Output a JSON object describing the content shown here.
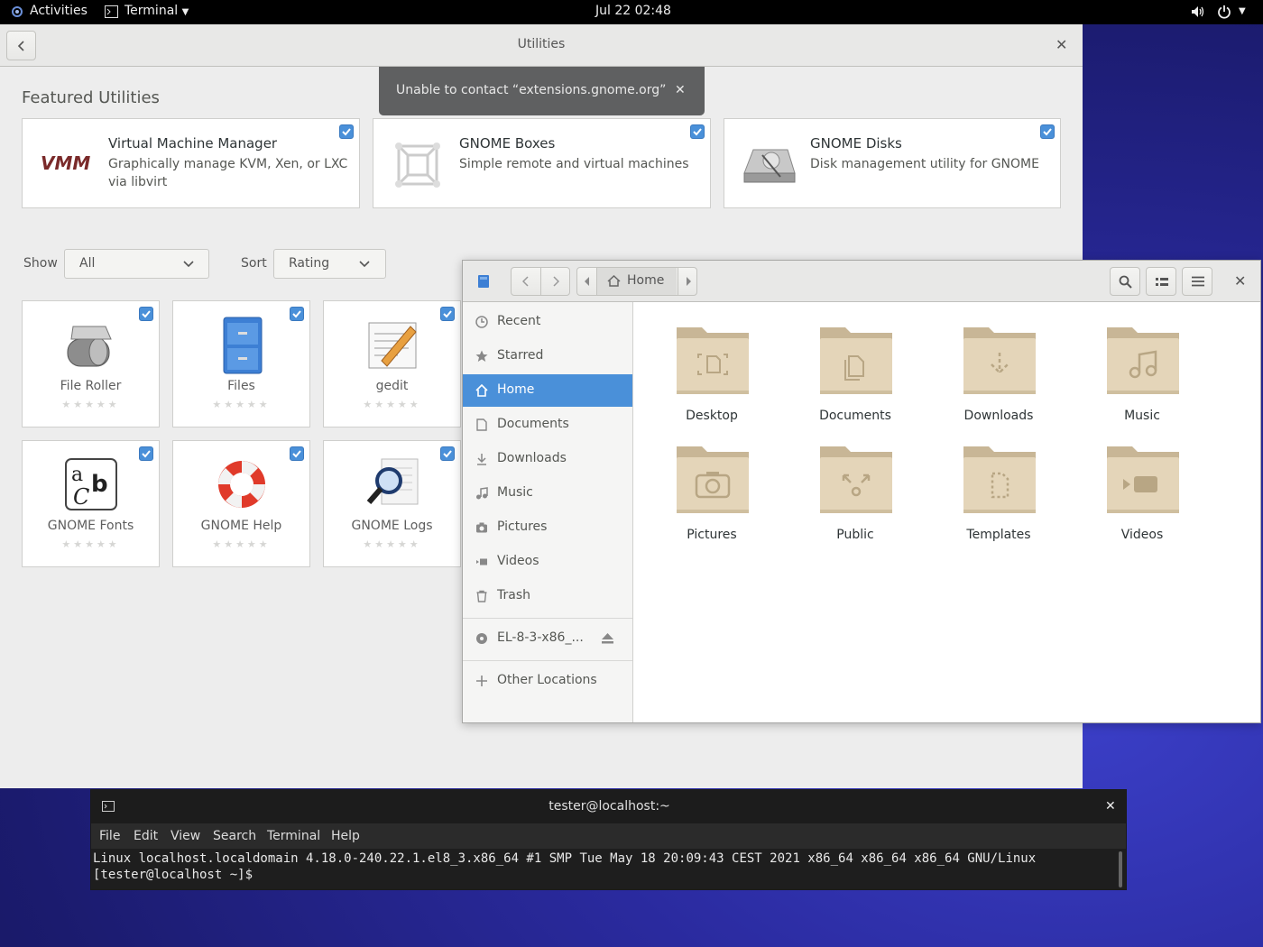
{
  "topbar": {
    "activities": "Activities",
    "app_menu": "Terminal",
    "clock": "Jul 22  02:48"
  },
  "software": {
    "title": "Utilities",
    "featured_heading": "Featured Utilities",
    "featured": [
      {
        "name": "Virtual Machine Manager",
        "desc1": "Graphically manage KVM, Xen, or LXC",
        "desc2": "via libvirt"
      },
      {
        "name": "GNOME Boxes",
        "desc1": "Simple remote and virtual machines",
        "desc2": ""
      },
      {
        "name": "GNOME Disks",
        "desc1": "Disk management utility for GNOME",
        "desc2": ""
      }
    ],
    "show_label": "Show",
    "show_value": "All",
    "sort_label": "Sort",
    "sort_value": "Rating",
    "apps": [
      {
        "name": "File Roller"
      },
      {
        "name": "Files"
      },
      {
        "name": "gedit"
      },
      {
        "name": "GNOME Fonts"
      },
      {
        "name": "GNOME Help"
      },
      {
        "name": "GNOME Logs"
      }
    ],
    "stars": "★★★★★"
  },
  "notification": {
    "text": "Unable to contact “extensions.gnome.org”"
  },
  "files": {
    "path_home": "Home",
    "sidebar": [
      {
        "label": "Recent"
      },
      {
        "label": "Starred"
      },
      {
        "label": "Home"
      },
      {
        "label": "Documents"
      },
      {
        "label": "Downloads"
      },
      {
        "label": "Music"
      },
      {
        "label": "Pictures"
      },
      {
        "label": "Videos"
      },
      {
        "label": "Trash"
      },
      {
        "label": "EL-8-3-x86_..."
      },
      {
        "label": "Other Locations"
      }
    ],
    "folders": [
      {
        "label": "Desktop"
      },
      {
        "label": "Documents"
      },
      {
        "label": "Downloads"
      },
      {
        "label": "Music"
      },
      {
        "label": "Pictures"
      },
      {
        "label": "Public"
      },
      {
        "label": "Templates"
      },
      {
        "label": "Videos"
      }
    ]
  },
  "terminal": {
    "title": "tester@localhost:~",
    "menu": [
      "File",
      "Edit",
      "View",
      "Search",
      "Terminal",
      "Help"
    ],
    "line1": "Linux localhost.localdomain 4.18.0-240.22.1.el8_3.x86_64 #1 SMP Tue May 18 20:09:43 CEST 2021 x86_64 x86_64 x86_64 GNU/Linux",
    "line2": "[tester@localhost ~]$ "
  },
  "colors": {
    "accent": "#4a90d9",
    "folder": "#dccbb0"
  }
}
